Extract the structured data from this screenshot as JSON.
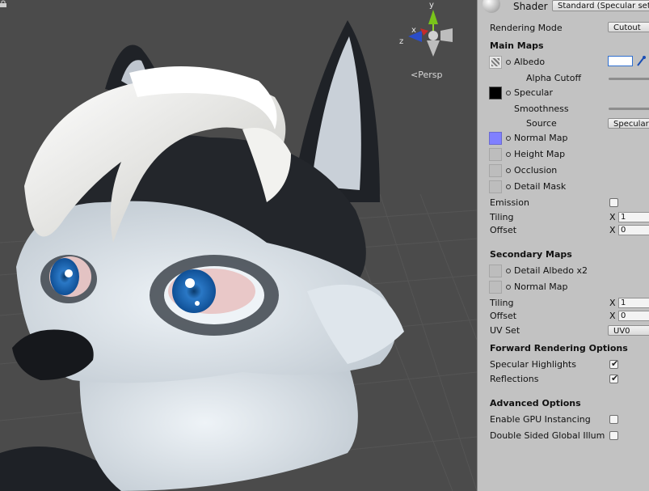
{
  "scene": {
    "view_label": "<Persp",
    "gizmo_axes": {
      "y": "y",
      "x": "x",
      "z": "z"
    }
  },
  "inspector": {
    "shader_label": "Shader",
    "shader_value": "Standard (Specular set",
    "rendering_mode_label": "Rendering Mode",
    "rendering_mode_value": "Cutout",
    "main_maps": "Main Maps",
    "albedo": "Albedo",
    "alpha_cutoff": "Alpha Cutoff",
    "specular": "Specular",
    "smoothness": "Smoothness",
    "source": "Source",
    "source_value": "Specular",
    "normal_map": "Normal Map",
    "height_map": "Height Map",
    "occlusion": "Occlusion",
    "detail_mask": "Detail Mask",
    "emission": "Emission",
    "tiling": "Tiling",
    "offset": "Offset",
    "x_label": "X",
    "tiling_x": "1",
    "offset_x": "0",
    "secondary_maps": "Secondary Maps",
    "detail_albedo": "Detail Albedo x2",
    "normal_map2": "Normal Map",
    "tiling2": "Tiling",
    "offset2": "Offset",
    "tiling2_x": "1",
    "offset2_x": "0",
    "uv_set": "UV Set",
    "uv_set_value": "UV0",
    "forward_options": "Forward Rendering Options",
    "specular_highlights": "Specular Highlights",
    "reflections": "Reflections",
    "advanced_options": "Advanced Options",
    "gpu_instancing": "Enable GPU Instancing",
    "double_sided_gi": "Double Sided Global Illum"
  },
  "colors": {
    "albedo_swatch": "#ffffff",
    "specular_swatch": "#000000",
    "normal_map_swatch": "#8080ff",
    "checkmark": "#222222"
  }
}
